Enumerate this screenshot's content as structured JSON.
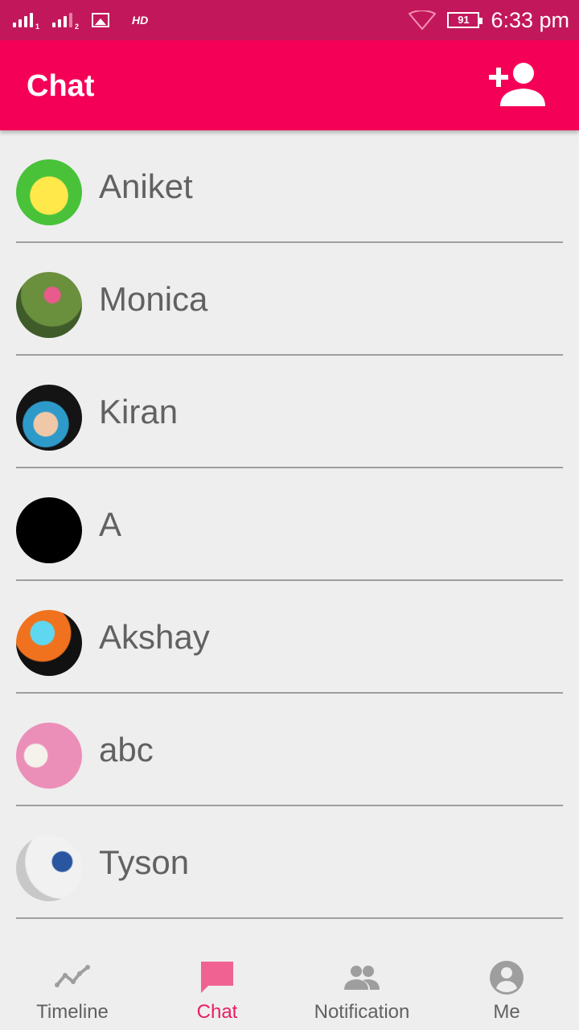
{
  "status_bar": {
    "hd_label": "HD",
    "battery_level": "91",
    "time": "6:33 pm",
    "icons": [
      "signal-sim1-icon",
      "signal-sim2-icon",
      "image-notification-icon",
      "wifi-icon",
      "battery-icon"
    ]
  },
  "app_bar": {
    "title": "Chat",
    "action_icon": "add-contact-icon",
    "color": "#f50057"
  },
  "chats": [
    {
      "name": "Aniket"
    },
    {
      "name": "Monica"
    },
    {
      "name": "Kiran"
    },
    {
      "name": "A"
    },
    {
      "name": "Akshay"
    },
    {
      "name": "abc"
    },
    {
      "name": "Tyson"
    }
  ],
  "bottom_nav": {
    "items": [
      {
        "label": "Timeline",
        "icon": "timeline-icon",
        "active": false
      },
      {
        "label": "Chat",
        "icon": "chat-icon",
        "active": true
      },
      {
        "label": "Notification",
        "icon": "people-icon",
        "active": false
      },
      {
        "label": "Me",
        "icon": "account-circle-icon",
        "active": false
      }
    ],
    "active_color": "#e91e63",
    "inactive_color": "#616161"
  },
  "colors": {
    "status_bar": "#c2185b",
    "background": "#eeeeee"
  }
}
